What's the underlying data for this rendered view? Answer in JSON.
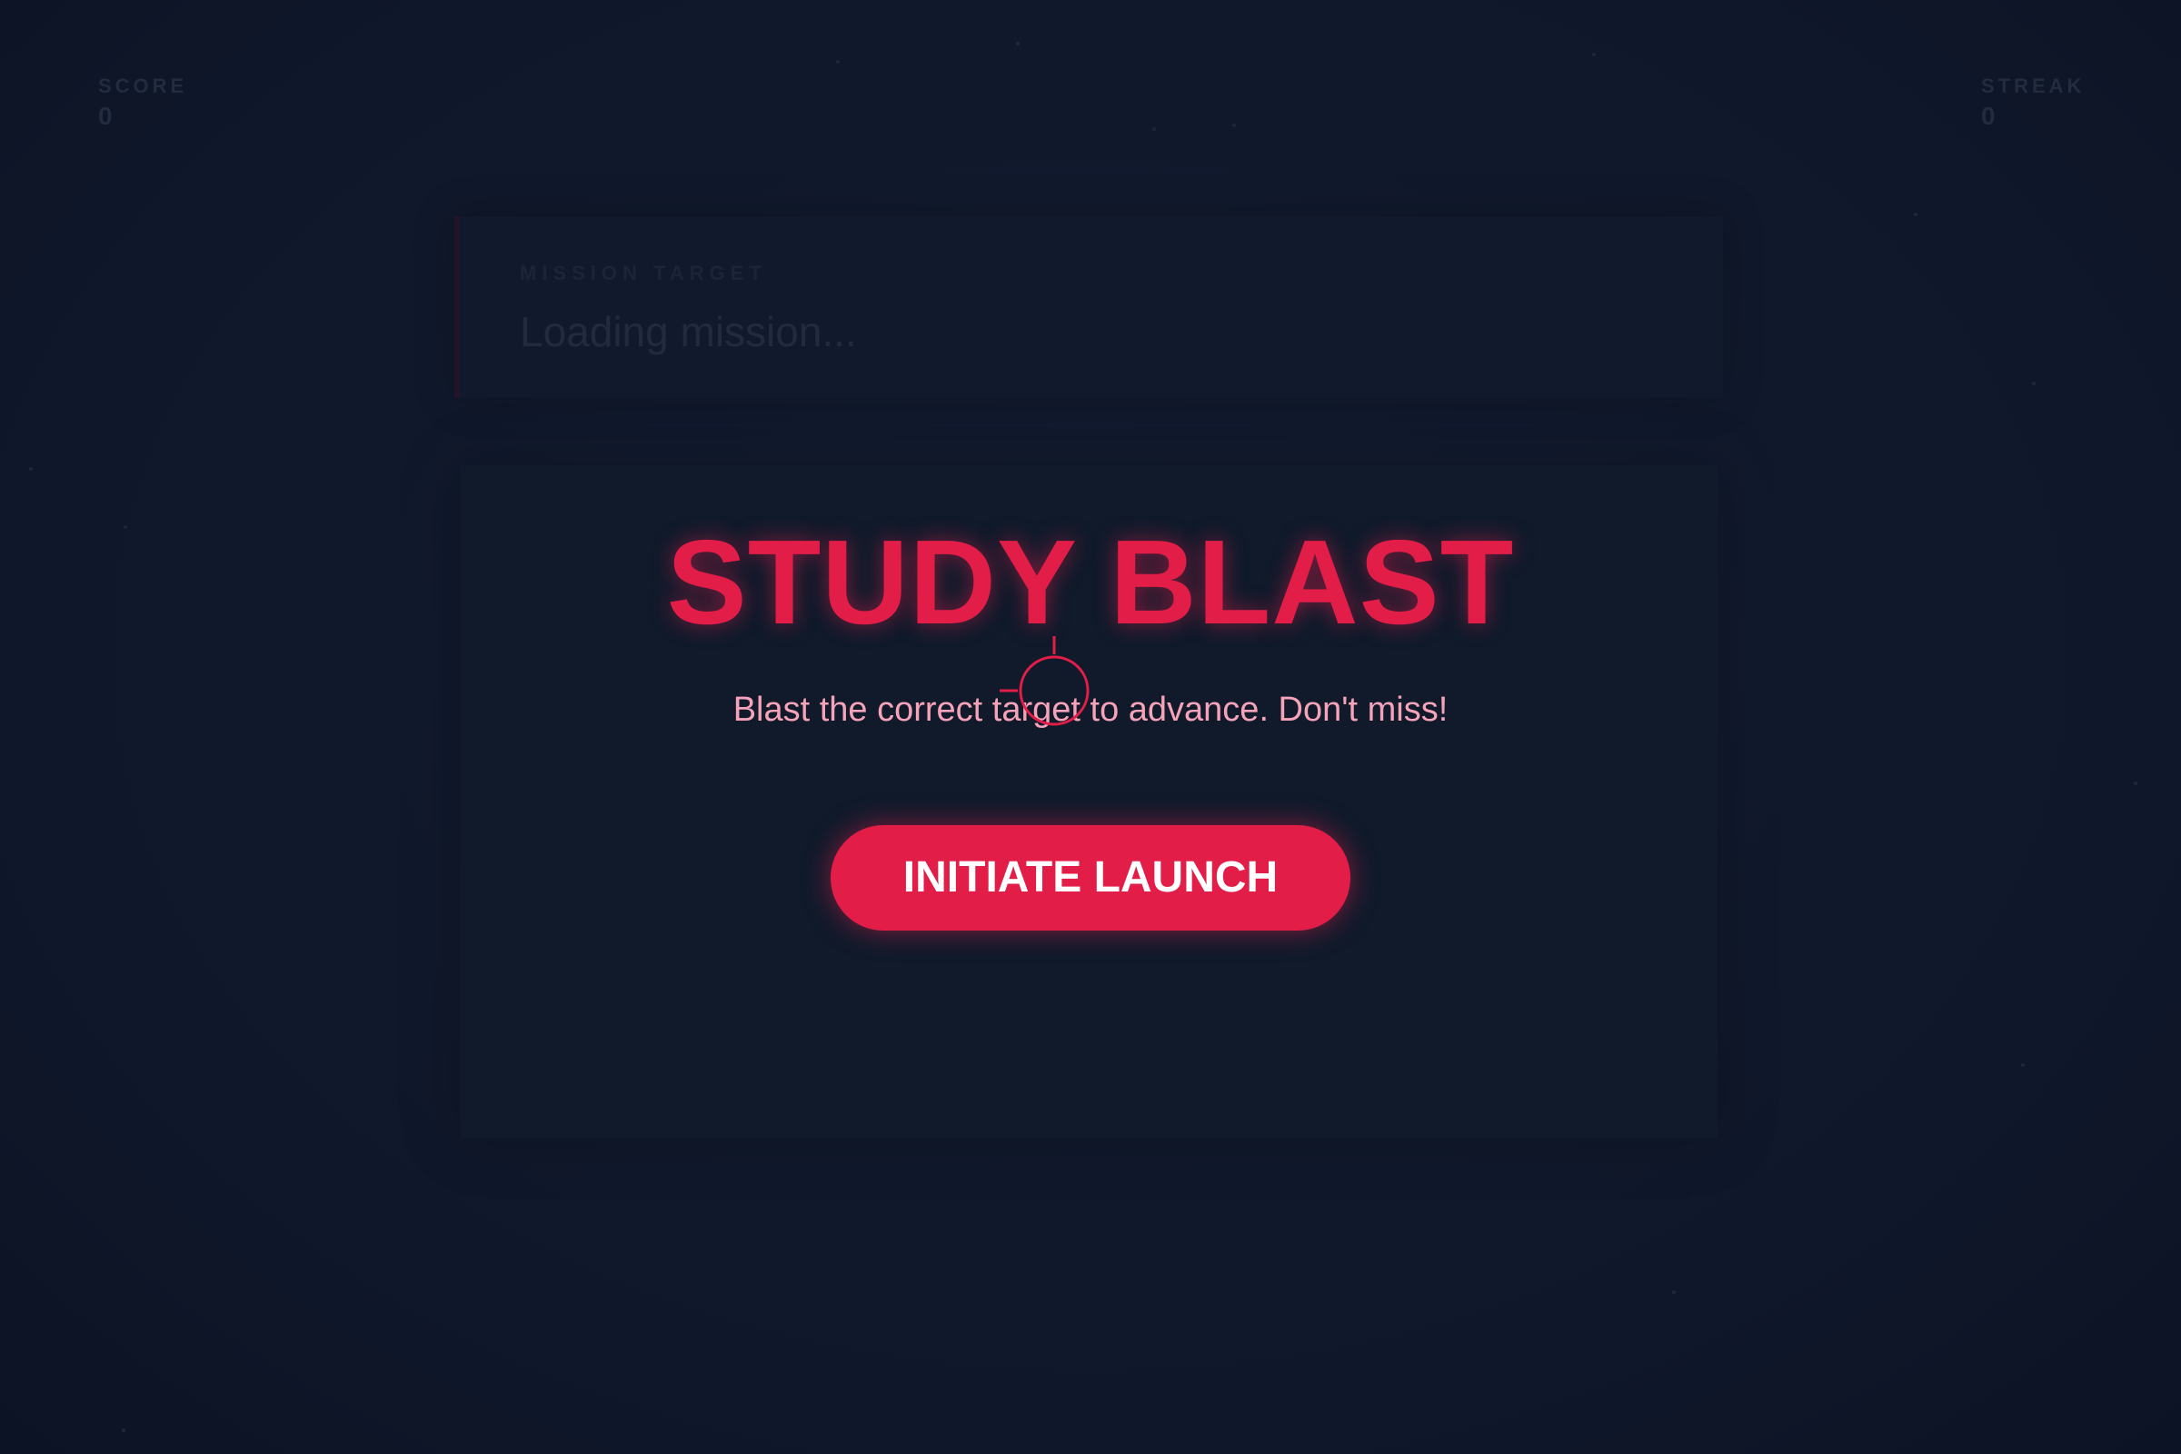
{
  "hud": {
    "score_label": "SCORE",
    "score_value": "0",
    "streak_label": "STREAK",
    "streak_value": "0"
  },
  "mission": {
    "label": "MISSION TARGET",
    "text": "Loading mission..."
  },
  "intro": {
    "title": "STUDY BLAST",
    "subtitle": "Blast the correct target to advance. Don't miss!",
    "button_label": "INITIATE LAUNCH"
  },
  "colors": {
    "accent": "#e11d48",
    "subtitle": "#f5a3b8",
    "background": "#0f172a"
  },
  "icons": {
    "cursor": "crosshair-icon"
  }
}
